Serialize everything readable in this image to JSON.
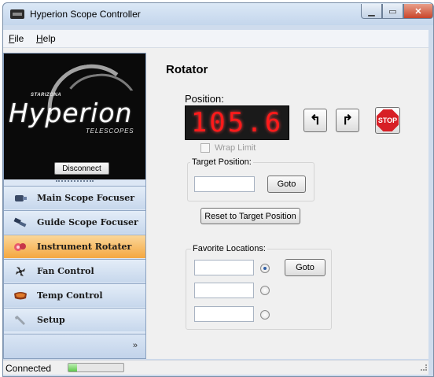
{
  "window": {
    "title": "Hyperion Scope Controller"
  },
  "menu": {
    "file": "File",
    "file_key": "F",
    "file_rest": "ile",
    "help": "Help",
    "help_key": "H",
    "help_rest": "elp"
  },
  "logo": {
    "brand": "STARIZONA",
    "name": "Hyperion",
    "sub": "TELESCOPES"
  },
  "sidebar": {
    "disconnect_label": "Disconnect",
    "items": [
      {
        "label": "Main Scope Focuser",
        "icon": "focuser-icon",
        "active": false
      },
      {
        "label": "Guide Scope Focuser",
        "icon": "guide-focuser-icon",
        "active": false
      },
      {
        "label": "Instrument Rotater",
        "icon": "rotator-icon",
        "active": true
      },
      {
        "label": "Fan Control",
        "icon": "fan-icon",
        "active": false
      },
      {
        "label": "Temp Control",
        "icon": "heater-icon",
        "active": false
      },
      {
        "label": "Setup",
        "icon": "wrench-icon",
        "active": false
      }
    ],
    "expand_glyph": "»"
  },
  "rotator": {
    "title": "Rotator",
    "position_label": "Position:",
    "position_value": "105.6",
    "stop_label": "STOP",
    "wrap_limit_label": "Wrap Limit",
    "wrap_limit_checked": false,
    "target_group_label": "Target Position:",
    "target_value": "",
    "goto_label": "Goto",
    "reset_label": "Reset to Target Position",
    "favorites_group_label": "Favorite Locations:",
    "favorites": [
      {
        "value": "",
        "selected": true
      },
      {
        "value": "",
        "selected": false
      },
      {
        "value": "",
        "selected": false
      }
    ],
    "favorites_goto_label": "Goto"
  },
  "status": {
    "text": "Connected",
    "progress": 0.15
  },
  "colors": {
    "active_nav": "#f4a740",
    "display_digits": "#ff1a1a",
    "stop": "#d71f26"
  }
}
